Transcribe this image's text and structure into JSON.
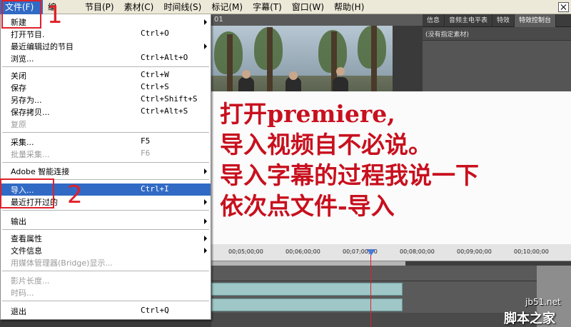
{
  "menubar": {
    "items": [
      "文件(F)",
      "编",
      "节目(P)",
      "素材(C)",
      "时间线(S)",
      "标记(M)",
      "字幕(T)",
      "窗口(W)",
      "帮助(H)"
    ]
  },
  "monitor": {
    "tab_label": "01"
  },
  "effects_panel": {
    "tabs": [
      "信息",
      "音频主电平表",
      "特效",
      "特效控制台"
    ],
    "status": "(没有指定素材)"
  },
  "caption": {
    "lines": [
      "打开premiere,",
      "导入视频自不必说。",
      "导入字幕的过程我说一下",
      "依次点文件-导入"
    ]
  },
  "timeline": {
    "ticks": [
      "00;05;00;00",
      "00;06;00;00",
      "00;07;00;00",
      "00;08;00;00",
      "00;09;00;00",
      "00;10;00;00"
    ]
  },
  "file_menu": {
    "items": [
      {
        "label": "新建",
        "shortcut": "",
        "submenu": true,
        "disabled": false,
        "highlight": false
      },
      {
        "label": "打开节目.",
        "shortcut": "Ctrl+O",
        "submenu": false,
        "disabled": false,
        "highlight": false
      },
      {
        "label": "最近编辑过的节目",
        "shortcut": "",
        "submenu": true,
        "disabled": false,
        "highlight": false
      },
      {
        "label": "浏览...",
        "shortcut": "Ctrl+Alt+O",
        "submenu": false,
        "disabled": false,
        "highlight": false
      },
      {
        "label": "关闭",
        "shortcut": "Ctrl+W",
        "submenu": false,
        "disabled": false,
        "highlight": false
      },
      {
        "label": "保存",
        "shortcut": "Ctrl+S",
        "submenu": false,
        "disabled": false,
        "highlight": false
      },
      {
        "label": "另存为...",
        "shortcut": "Ctrl+Shift+S",
        "submenu": false,
        "disabled": false,
        "highlight": false
      },
      {
        "label": "保存拷贝...",
        "shortcut": "Ctrl+Alt+S",
        "submenu": false,
        "disabled": false,
        "highlight": false
      },
      {
        "label": "复原",
        "shortcut": "",
        "submenu": false,
        "disabled": true,
        "highlight": false
      },
      {
        "label": "采集...",
        "shortcut": "F5",
        "submenu": false,
        "disabled": false,
        "highlight": false
      },
      {
        "label": "批量采集...",
        "shortcut": "F6",
        "submenu": false,
        "disabled": true,
        "highlight": false
      },
      {
        "label": "Adobe 智能连接",
        "shortcut": "",
        "submenu": true,
        "disabled": false,
        "highlight": false
      },
      {
        "label": "导入...",
        "shortcut": "Ctrl+I",
        "submenu": false,
        "disabled": false,
        "highlight": true
      },
      {
        "label": "最近打开过的",
        "shortcut": "",
        "submenu": true,
        "disabled": false,
        "highlight": false
      },
      {
        "label": "输出",
        "shortcut": "",
        "submenu": true,
        "disabled": false,
        "highlight": false
      },
      {
        "label": "查看属性",
        "shortcut": "",
        "submenu": true,
        "disabled": false,
        "highlight": false
      },
      {
        "label": "文件信息",
        "shortcut": "",
        "submenu": true,
        "disabled": false,
        "highlight": false
      },
      {
        "label": "用媒体管理器(Bridge)显示...",
        "shortcut": "",
        "submenu": false,
        "disabled": true,
        "highlight": false
      },
      {
        "label": "影片长度...",
        "shortcut": "",
        "submenu": false,
        "disabled": true,
        "highlight": false
      },
      {
        "label": "时码...",
        "shortcut": "",
        "submenu": false,
        "disabled": true,
        "highlight": false
      },
      {
        "label": "退出",
        "shortcut": "Ctrl+Q",
        "submenu": false,
        "disabled": false,
        "highlight": false
      }
    ]
  },
  "annotations": {
    "step1": "1",
    "step2": "2"
  },
  "watermark": {
    "url": "jb51.net",
    "name": "脚本之家"
  },
  "colors": {
    "menu_highlight": "#316ac5",
    "annotation_red": "#e0202a",
    "caption_red": "#c8101e"
  }
}
